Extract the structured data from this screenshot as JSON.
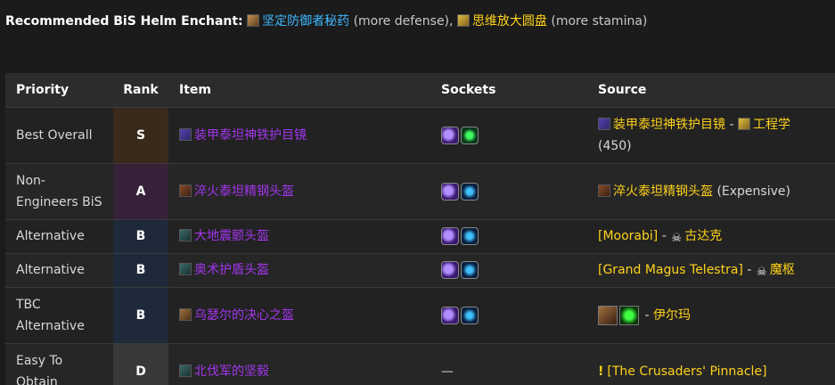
{
  "header": {
    "label": "Recommended BiS Helm Enchant",
    "colon": ":",
    "enchant_a": "坚定防御者秘药",
    "enchant_a_note": "(more defense),",
    "enchant_b": "思维放大圆盘",
    "enchant_b_note": "(more stamina)"
  },
  "table": {
    "columns": [
      "Priority",
      "Rank",
      "Item",
      "Sockets",
      "Source"
    ],
    "rows": [
      {
        "priority": "Best Overall",
        "rank": "S",
        "item": "装甲泰坦神铁护目镜",
        "sockets": [
          "meta-gem-icon",
          "green-gem-icon"
        ],
        "source_link": "装甲泰坦神铁护目镜",
        "source_sep": " - ",
        "source_link2": "工程学",
        "source_extra": "(450)"
      },
      {
        "priority": "Non-Engineers BiS",
        "rank": "A",
        "item": "淬火泰坦精钢头盔",
        "sockets": [
          "meta-gem-icon",
          "blue-gem-icon"
        ],
        "source_link": "淬火泰坦精钢头盔",
        "source_extra": "(Expensive)"
      },
      {
        "priority": "Alternative",
        "rank": "B",
        "item": "大地震颤头盔",
        "sockets": [
          "meta-gem-icon",
          "blue-gem-icon"
        ],
        "source_link": "[Moorabi]",
        "source_sep": " - ",
        "source_link2": "古达克"
      },
      {
        "priority": "Alternative",
        "rank": "B",
        "item": "奥术护盾头盔",
        "sockets": [
          "meta-gem-icon",
          "blue-gem-icon"
        ],
        "source_link": "[Grand Magus Telestra]",
        "source_sep": " - ",
        "source_link2": "魔枢"
      },
      {
        "priority": "TBC Alternative",
        "rank": "B",
        "item": "乌瑟尔的决心之盔",
        "sockets": [
          "meta-gem-icon",
          "blue-gem-icon"
        ],
        "source_sep": " - ",
        "source_link2": "伊尔玛"
      },
      {
        "priority": "Easy To Obtain",
        "rank": "D",
        "item": "北伐军的坚毅",
        "sockets_text": "—",
        "source_link": "[The Crusaders' Pinnacle]"
      }
    ]
  },
  "colors": {
    "epic": "#a335ee",
    "gold": "#ffd21a",
    "cyan": "#3fb8ff",
    "background": "#1b1b1b"
  }
}
